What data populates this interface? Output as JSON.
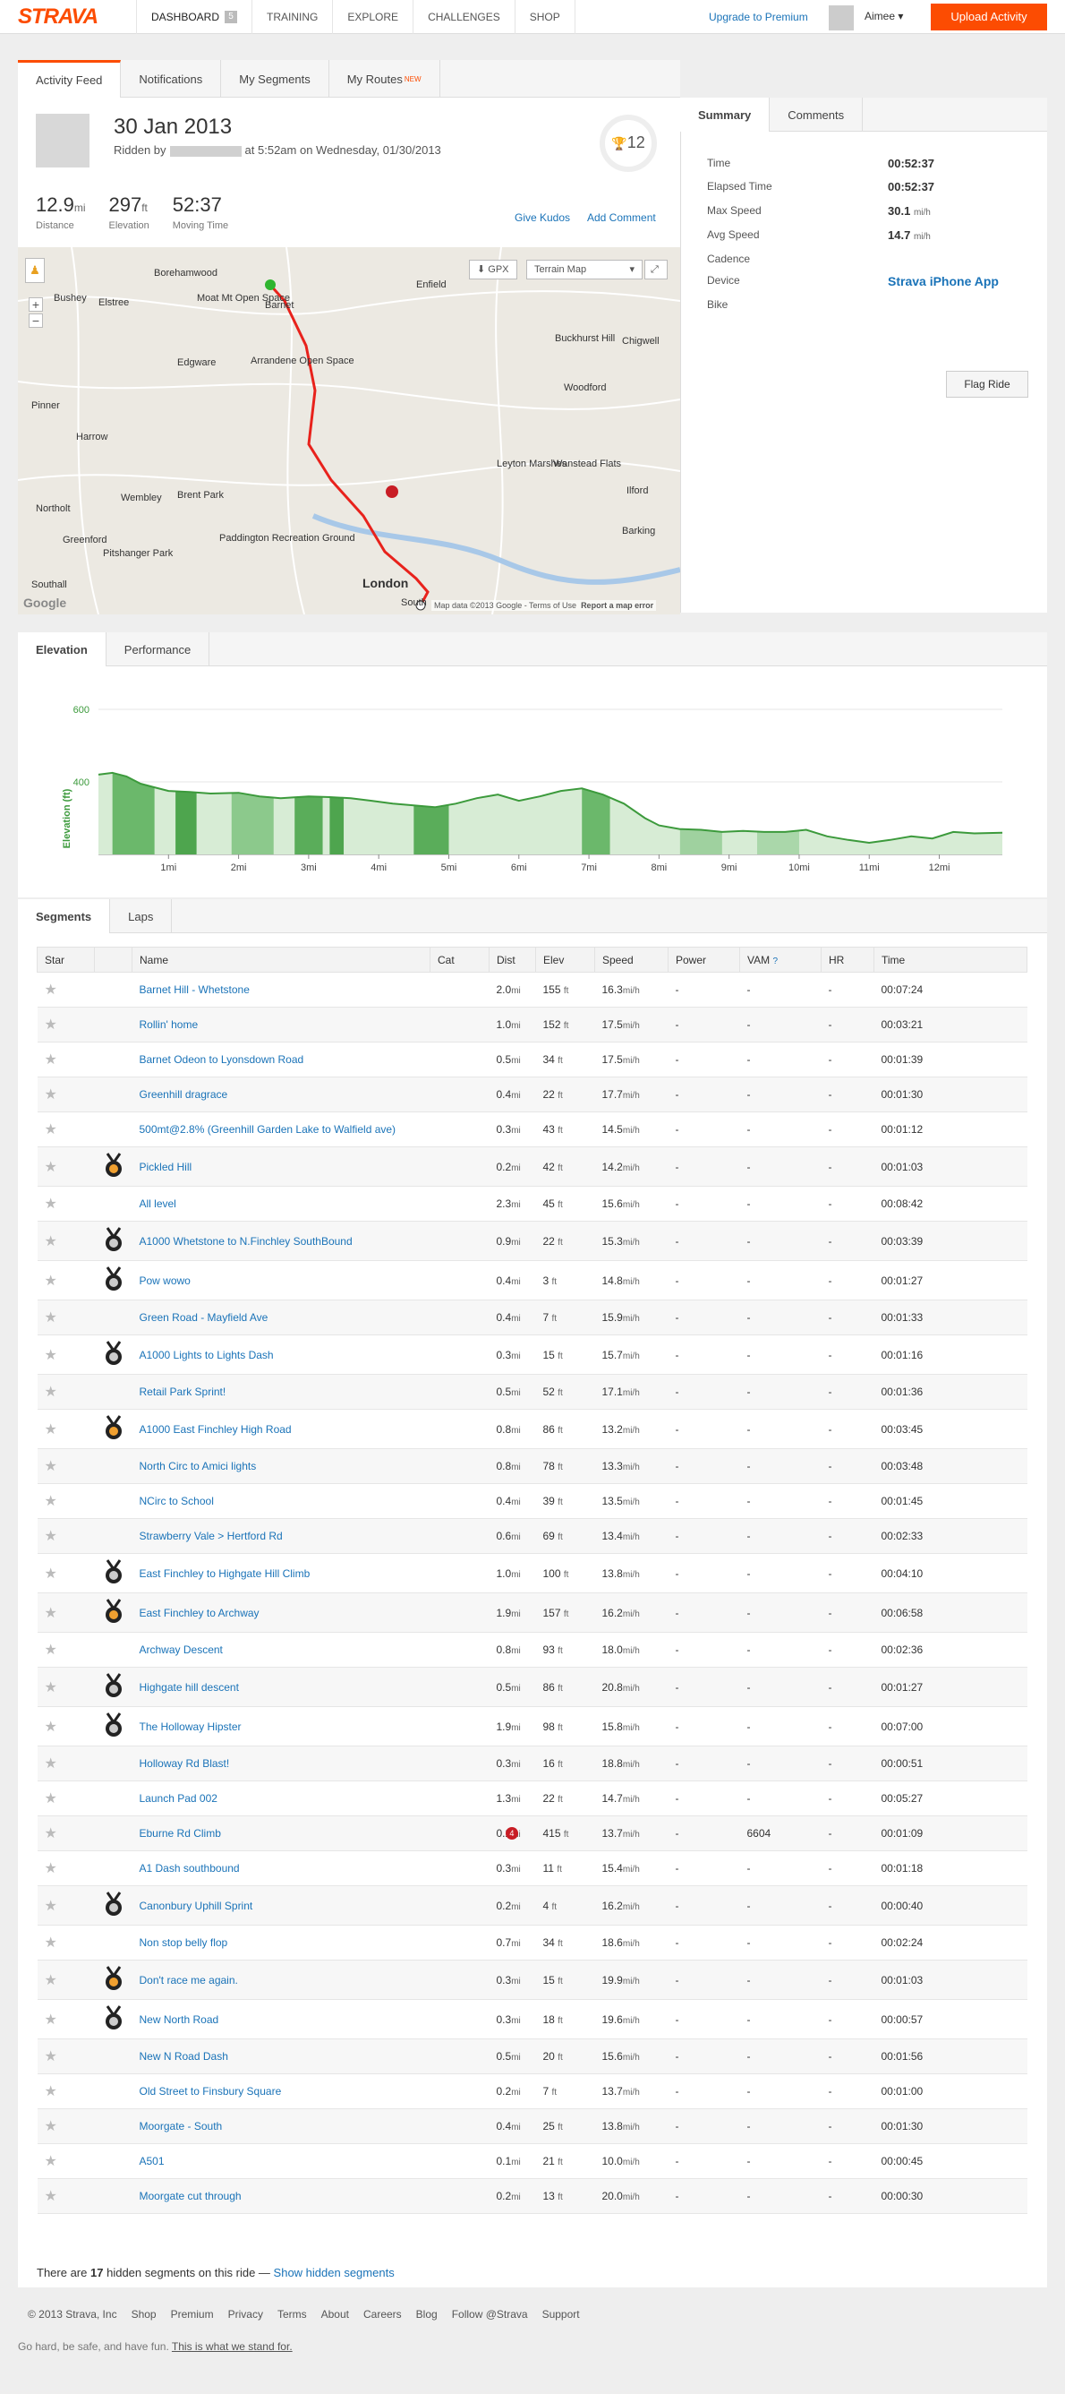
{
  "nav": {
    "logo": "STRAVA",
    "items": [
      "DASHBOARD",
      "TRAINING",
      "EXPLORE",
      "CHALLENGES",
      "SHOP"
    ],
    "dashboard_badge": "5",
    "upgrade": "Upgrade to Premium",
    "user": "Aimee ▾",
    "upload": "Upload Activity"
  },
  "tabs": {
    "main": [
      "Activity Feed",
      "Notifications",
      "My Segments",
      "My Routes"
    ],
    "new_tag": "NEW",
    "side": [
      "Summary",
      "Comments"
    ],
    "chart": [
      "Elevation",
      "Performance"
    ],
    "segments": [
      "Segments",
      "Laps"
    ]
  },
  "activity": {
    "date": "30 Jan 2013",
    "ridden_by": "Ridden by",
    "ridden_time": "at 5:52am on Wednesday, 01/30/2013",
    "achievements": "12",
    "distance": "12.9",
    "distance_unit": "mi",
    "distance_label": "Distance",
    "elevation": "297",
    "elevation_unit": "ft",
    "elevation_label": "Elevation",
    "moving_time": "52:37",
    "moving_time_label": "Moving Time",
    "give_kudos": "Give Kudos",
    "add_comment": "Add Comment"
  },
  "map": {
    "gpx": "GPX",
    "type": "Terrain Map",
    "attribution": "Map data ©2013 Google - Terms of Use",
    "report": "Report a map error",
    "places": [
      "Borehamwood",
      "Barnet",
      "Enfield",
      "Bushey",
      "Elstree",
      "Moat Mt Open Space",
      "Edgware",
      "Arrandene Open Space",
      "Buckhurst Hill",
      "Chigwell",
      "Woodford",
      "Pinner",
      "Harrow",
      "Leyton Marshes",
      "Wanstead Flats",
      "Ilford",
      "Northolt",
      "Wembley",
      "Brent Park",
      "Barking",
      "Greenford",
      "Paddington Recreation Ground",
      "Pitshanger Park",
      "London",
      "Southall",
      "South"
    ],
    "google": "Google"
  },
  "summary": {
    "rows": [
      {
        "label": "Time",
        "value": "00:52:37",
        "unit": ""
      },
      {
        "label": "Elapsed Time",
        "value": "00:52:37",
        "unit": ""
      },
      {
        "label": "Max Speed",
        "value": "30.1",
        "unit": "mi/h"
      },
      {
        "label": "Avg Speed",
        "value": "14.7",
        "unit": "mi/h"
      },
      {
        "label": "Cadence",
        "value": "",
        "unit": ""
      },
      {
        "label": "Device",
        "value": "Strava iPhone App",
        "unit": ""
      },
      {
        "label": "Bike",
        "value": "",
        "unit": ""
      }
    ],
    "flag": "Flag Ride"
  },
  "chart_data": {
    "type": "area",
    "ylabel": "Elevation (ft)",
    "xlabel": "",
    "yticks": [
      400,
      600
    ],
    "ylim": [
      200,
      600
    ],
    "xticks": [
      "1mi",
      "2mi",
      "3mi",
      "4mi",
      "5mi",
      "6mi",
      "7mi",
      "8mi",
      "9mi",
      "10mi",
      "11mi",
      "12mi"
    ],
    "x": [
      0,
      0.2,
      0.4,
      0.6,
      0.8,
      1.0,
      1.3,
      1.6,
      2.0,
      2.3,
      2.6,
      3.0,
      3.3,
      3.6,
      3.9,
      4.2,
      4.5,
      4.8,
      5.1,
      5.4,
      5.7,
      6.0,
      6.3,
      6.6,
      6.9,
      7.2,
      7.5,
      7.8,
      8.0,
      8.3,
      8.6,
      8.9,
      9.2,
      9.5,
      9.8,
      10.1,
      10.4,
      10.7,
      11.0,
      11.3,
      11.6,
      11.9,
      12.2,
      12.5,
      12.9
    ],
    "y": [
      420,
      425,
      415,
      395,
      385,
      375,
      372,
      368,
      370,
      360,
      355,
      360,
      358,
      355,
      348,
      340,
      335,
      330,
      340,
      355,
      365,
      348,
      360,
      375,
      382,
      365,
      340,
      300,
      280,
      270,
      268,
      262,
      265,
      262,
      262,
      268,
      250,
      240,
      232,
      240,
      250,
      244,
      262,
      258,
      260
    ]
  },
  "segments": {
    "headers": [
      "Star",
      "",
      "Name",
      "Cat",
      "Dist",
      "Elev",
      "Speed",
      "Power",
      "VAM",
      "HR",
      "Time"
    ],
    "vam_help": "?",
    "dist_unit": "mi",
    "elev_unit": "ft",
    "speed_unit": "mi/h",
    "dash": "-",
    "rows": [
      {
        "name": "Barnet Hill - Whetstone",
        "medal": "",
        "rank": "",
        "dist": "2.0",
        "elev": "155",
        "speed": "16.3",
        "vam": "-",
        "time": "00:07:24"
      },
      {
        "name": "Rollin' home",
        "medal": "",
        "rank": "",
        "dist": "1.0",
        "elev": "152",
        "speed": "17.5",
        "vam": "-",
        "time": "00:03:21"
      },
      {
        "name": "Barnet Odeon to Lyonsdown Road",
        "medal": "",
        "rank": "",
        "dist": "0.5",
        "elev": "34",
        "speed": "17.5",
        "vam": "-",
        "time": "00:01:39"
      },
      {
        "name": "Greenhill dragrace",
        "medal": "",
        "rank": "",
        "dist": "0.4",
        "elev": "22",
        "speed": "17.7",
        "vam": "-",
        "time": "00:01:30"
      },
      {
        "name": "500mt@2.8% (Greenhill Garden Lake to Walfield ave)",
        "medal": "",
        "rank": "",
        "dist": "0.3",
        "elev": "43",
        "speed": "14.5",
        "vam": "-",
        "time": "00:01:12"
      },
      {
        "name": "Pickled Hill",
        "medal": "gold",
        "rank": "",
        "dist": "0.2",
        "elev": "42",
        "speed": "14.2",
        "vam": "-",
        "time": "00:01:03"
      },
      {
        "name": "All level",
        "medal": "",
        "rank": "",
        "dist": "2.3",
        "elev": "45",
        "speed": "15.6",
        "vam": "-",
        "time": "00:08:42"
      },
      {
        "name": "A1000 Whetstone to N.Finchley SouthBound",
        "medal": "silver",
        "rank": "",
        "dist": "0.9",
        "elev": "22",
        "speed": "15.3",
        "vam": "-",
        "time": "00:03:39"
      },
      {
        "name": "Pow wowo",
        "medal": "silver",
        "rank": "",
        "dist": "0.4",
        "elev": "3",
        "speed": "14.8",
        "vam": "-",
        "time": "00:01:27"
      },
      {
        "name": "Green Road - Mayfield Ave",
        "medal": "",
        "rank": "",
        "dist": "0.4",
        "elev": "7",
        "speed": "15.9",
        "vam": "-",
        "time": "00:01:33"
      },
      {
        "name": "A1000 Lights to Lights Dash",
        "medal": "silver",
        "rank": "",
        "dist": "0.3",
        "elev": "15",
        "speed": "15.7",
        "vam": "-",
        "time": "00:01:16"
      },
      {
        "name": "Retail Park Sprint!",
        "medal": "",
        "rank": "",
        "dist": "0.5",
        "elev": "52",
        "speed": "17.1",
        "vam": "-",
        "time": "00:01:36"
      },
      {
        "name": "A1000 East Finchley High Road",
        "medal": "gold",
        "rank": "",
        "dist": "0.8",
        "elev": "86",
        "speed": "13.2",
        "vam": "-",
        "time": "00:03:45"
      },
      {
        "name": "North Circ to Amici lights",
        "medal": "",
        "rank": "",
        "dist": "0.8",
        "elev": "78",
        "speed": "13.3",
        "vam": "-",
        "time": "00:03:48"
      },
      {
        "name": "NCirc to School",
        "medal": "",
        "rank": "",
        "dist": "0.4",
        "elev": "39",
        "speed": "13.5",
        "vam": "-",
        "time": "00:01:45"
      },
      {
        "name": "Strawberry Vale > Hertford Rd",
        "medal": "",
        "rank": "",
        "dist": "0.6",
        "elev": "69",
        "speed": "13.4",
        "vam": "-",
        "time": "00:02:33"
      },
      {
        "name": "East Finchley to Highgate Hill Climb",
        "medal": "silver",
        "rank": "",
        "dist": "1.0",
        "elev": "100",
        "speed": "13.8",
        "vam": "-",
        "time": "00:04:10"
      },
      {
        "name": "East Finchley to Archway",
        "medal": "gold",
        "rank": "",
        "dist": "1.9",
        "elev": "157",
        "speed": "16.2",
        "vam": "-",
        "time": "00:06:58"
      },
      {
        "name": "Archway Descent",
        "medal": "",
        "rank": "",
        "dist": "0.8",
        "elev": "93",
        "speed": "18.0",
        "vam": "-",
        "time": "00:02:36"
      },
      {
        "name": "Highgate hill descent",
        "medal": "silver",
        "rank": "",
        "dist": "0.5",
        "elev": "86",
        "speed": "20.8",
        "vam": "-",
        "time": "00:01:27"
      },
      {
        "name": "The Holloway Hipster",
        "medal": "silver",
        "rank": "",
        "dist": "1.9",
        "elev": "98",
        "speed": "15.8",
        "vam": "-",
        "time": "00:07:00"
      },
      {
        "name": "Holloway Rd Blast!",
        "medal": "",
        "rank": "",
        "dist": "0.3",
        "elev": "16",
        "speed": "18.8",
        "vam": "-",
        "time": "00:00:51"
      },
      {
        "name": "Launch Pad 002",
        "medal": "",
        "rank": "",
        "dist": "1.3",
        "elev": "22",
        "speed": "14.7",
        "vam": "-",
        "time": "00:05:27"
      },
      {
        "name": "Eburne Rd Climb",
        "medal": "",
        "rank": "4",
        "dist": "0.2",
        "elev": "415",
        "speed": "13.7",
        "vam": "6604",
        "time": "00:01:09"
      },
      {
        "name": "A1 Dash southbound",
        "medal": "",
        "rank": "",
        "dist": "0.3",
        "elev": "11",
        "speed": "15.4",
        "vam": "-",
        "time": "00:01:18"
      },
      {
        "name": "Canonbury Uphill Sprint",
        "medal": "silver",
        "rank": "",
        "dist": "0.2",
        "elev": "4",
        "speed": "16.2",
        "vam": "-",
        "time": "00:00:40"
      },
      {
        "name": "Non stop belly flop",
        "medal": "",
        "rank": "",
        "dist": "0.7",
        "elev": "34",
        "speed": "18.6",
        "vam": "-",
        "time": "00:02:24"
      },
      {
        "name": "Don't race me again.",
        "medal": "gold",
        "rank": "",
        "dist": "0.3",
        "elev": "15",
        "speed": "19.9",
        "vam": "-",
        "time": "00:01:03"
      },
      {
        "name": "New North Road",
        "medal": "silver",
        "rank": "",
        "dist": "0.3",
        "elev": "18",
        "speed": "19.6",
        "vam": "-",
        "time": "00:00:57"
      },
      {
        "name": "New N Road Dash",
        "medal": "",
        "rank": "",
        "dist": "0.5",
        "elev": "20",
        "speed": "15.6",
        "vam": "-",
        "time": "00:01:56"
      },
      {
        "name": "Old Street to Finsbury Square",
        "medal": "",
        "rank": "",
        "dist": "0.2",
        "elev": "7",
        "speed": "13.7",
        "vam": "-",
        "time": "00:01:00"
      },
      {
        "name": "Moorgate - South",
        "medal": "",
        "rank": "",
        "dist": "0.4",
        "elev": "25",
        "speed": "13.8",
        "vam": "-",
        "time": "00:01:30"
      },
      {
        "name": "A501",
        "medal": "",
        "rank": "",
        "dist": "0.1",
        "elev": "21",
        "speed": "10.0",
        "vam": "-",
        "time": "00:00:45"
      },
      {
        "name": "Moorgate cut through",
        "medal": "",
        "rank": "",
        "dist": "0.2",
        "elev": "13",
        "speed": "20.0",
        "vam": "-",
        "time": "00:00:30"
      }
    ],
    "hidden_prefix": "There are",
    "hidden_count": "17",
    "hidden_suffix": "hidden segments on this ride —",
    "show_hidden": "Show hidden segments"
  },
  "footer": {
    "links": [
      "© 2013 Strava, Inc",
      "Shop",
      "Premium",
      "Privacy",
      "Terms",
      "About",
      "Careers",
      "Blog",
      "Follow @Strava",
      "Support"
    ],
    "tagline": "Go hard, be safe, and have fun.",
    "tagline_link": "This is what we stand for."
  },
  "colors": {
    "brand": "#fc4c02",
    "link": "#1a73b8",
    "route": "#e8221c",
    "elevation": "#3c9a3c"
  }
}
